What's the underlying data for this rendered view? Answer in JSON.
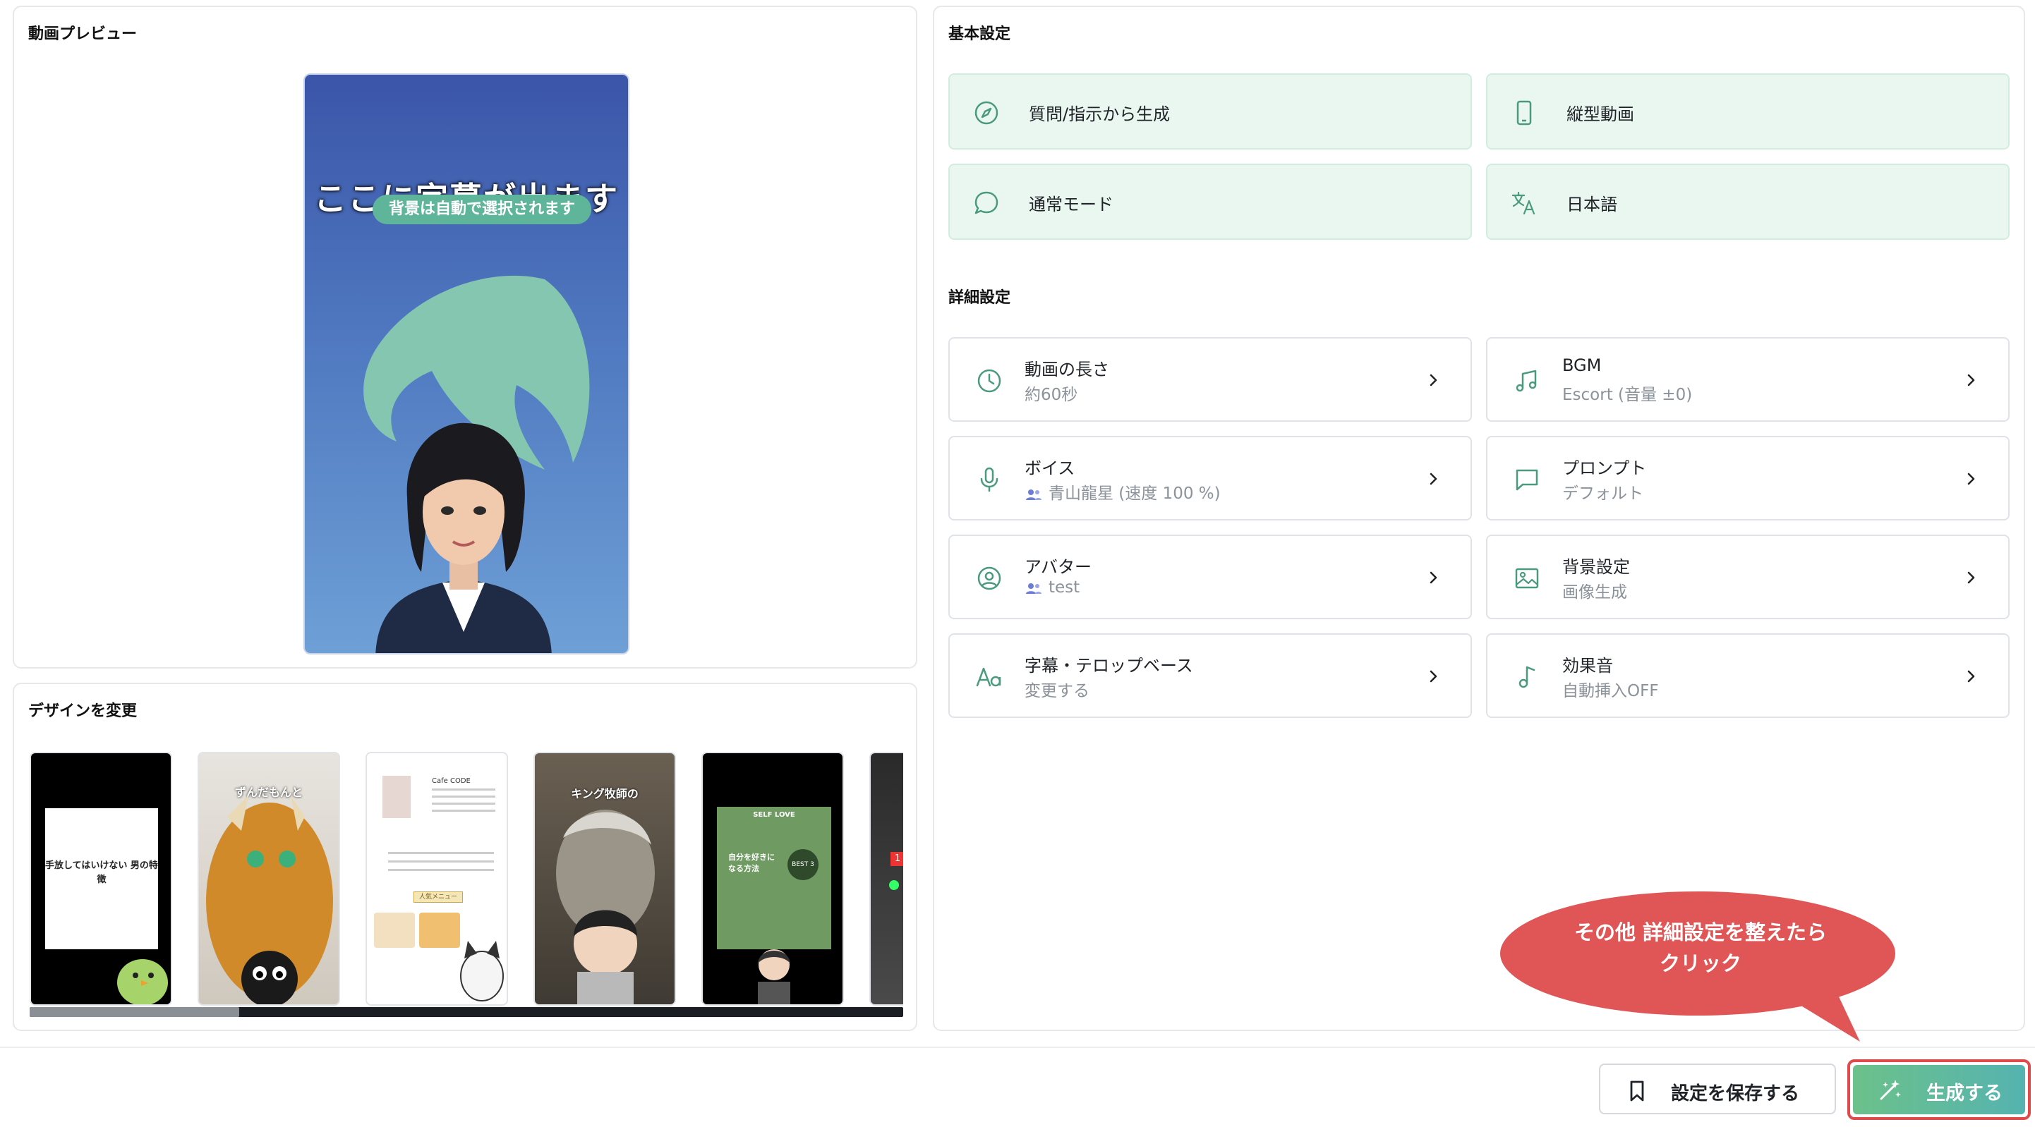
{
  "preview": {
    "title": "動画プレビュー",
    "subtitle_text": "ここに字幕が出ます",
    "background_badge": "背景は自動で選択されます"
  },
  "design": {
    "title": "デザインを変更",
    "thumbnails": [
      {
        "text": "手放してはいけない 男の特徴"
      },
      {
        "text": "ずんだもんと"
      },
      {
        "text": "Cafe CODE",
        "sub": "人気メニュー"
      },
      {
        "text": "キング牧師の"
      },
      {
        "text": "SELF LOVE",
        "sub": "自分を好きに なる方法",
        "badge": "BEST 3"
      },
      {
        "text": "1"
      }
    ],
    "scroll_position": 0.24
  },
  "basic": {
    "title": "基本設定",
    "items": [
      {
        "label": "質問/指示から生成",
        "icon": "compass-icon"
      },
      {
        "label": "縦型動画",
        "icon": "phone-icon"
      },
      {
        "label": "通常モード",
        "icon": "chat-bubble-icon"
      },
      {
        "label": "日本語",
        "icon": "translate-icon"
      }
    ]
  },
  "detail": {
    "title": "詳細設定",
    "items": [
      {
        "label": "動画の長さ",
        "value": "約60秒",
        "icon": "clock-icon"
      },
      {
        "label": "BGM",
        "value": "Escort (音量 ±0)",
        "icon": "music-icon"
      },
      {
        "label": "ボイス",
        "value": "青山龍星 (速度 100 %)",
        "icon": "microphone-icon"
      },
      {
        "label": "プロンプト",
        "value": "デフォルト",
        "icon": "message-square-icon"
      },
      {
        "label": "アバター",
        "value": "test",
        "icon": "user-circle-icon"
      },
      {
        "label": "背景設定",
        "value": "画像生成",
        "icon": "image-icon"
      },
      {
        "label": "字幕・テロップベース",
        "value": "変更する",
        "icon": "text-aa-icon"
      },
      {
        "label": "効果音",
        "value": "自動挿入OFF",
        "icon": "music-note-icon"
      }
    ]
  },
  "actions": {
    "save_label": "設定を保存する",
    "generate_label": "生成する"
  },
  "callout": {
    "line1": "その他 詳細設定を整えたら",
    "line2": "クリック"
  },
  "colors": {
    "accent_green": "#5fb59a",
    "basic_card_bg": "#eaf6f0",
    "generate_gradient_start": "#6cc18a",
    "generate_gradient_end": "#55b3b0",
    "callout_red": "#e05555"
  }
}
